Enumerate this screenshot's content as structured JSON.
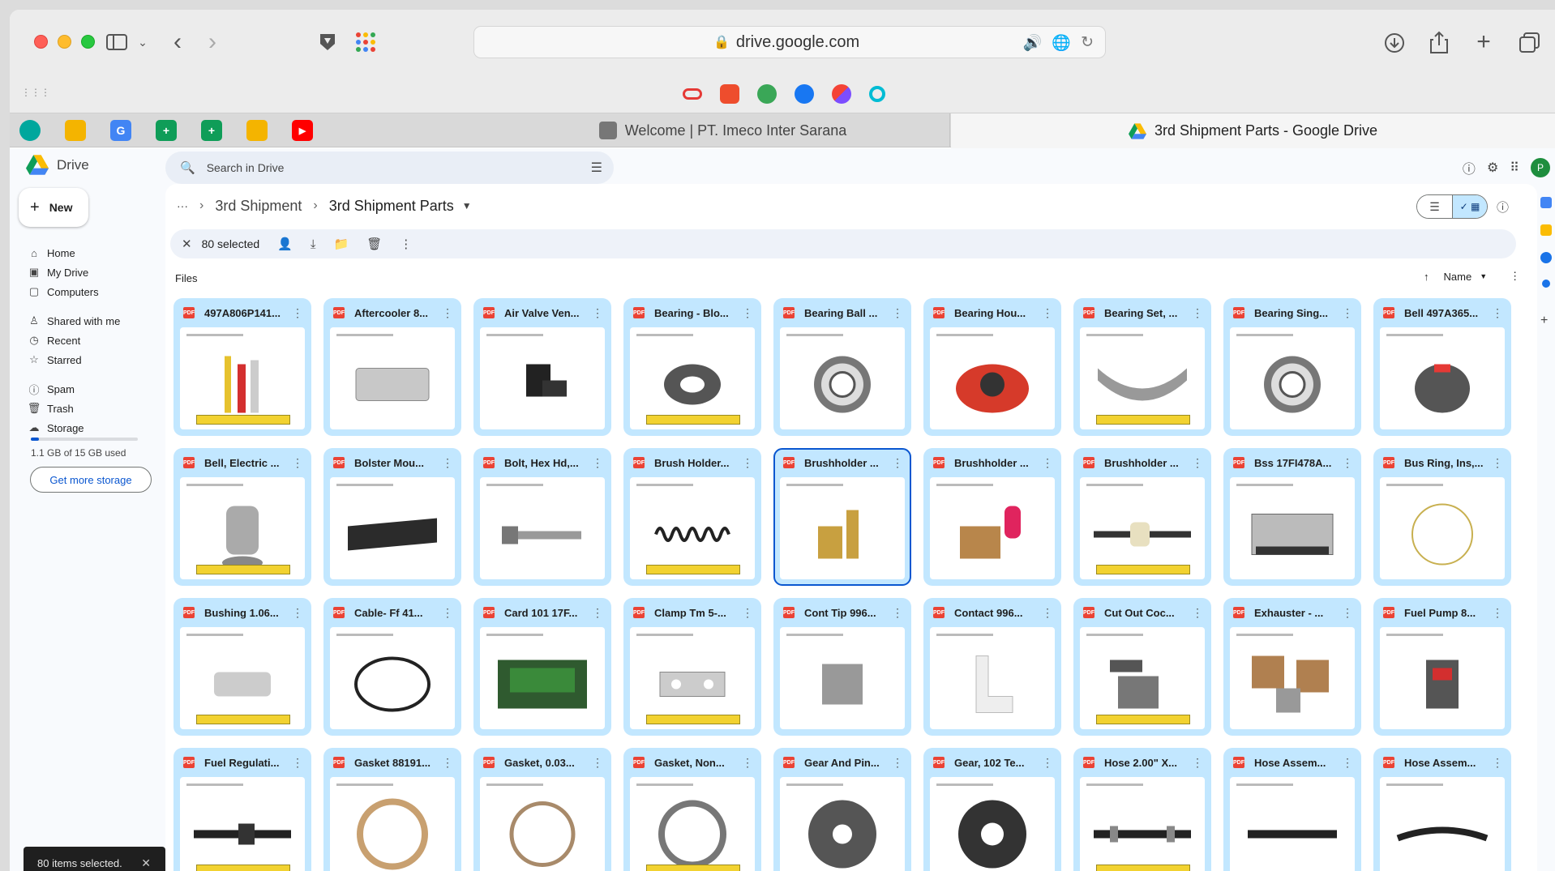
{
  "browser": {
    "url": "drive.google.com",
    "tabs": [
      {
        "title": "Welcome | PT. Imeco Inter Sarana"
      },
      {
        "title": "3rd Shipment Parts - Google Drive"
      }
    ]
  },
  "drive": {
    "app_name": "Drive",
    "search_placeholder": "Search in Drive",
    "new_label": "New",
    "nav": [
      {
        "label": "Home",
        "icon": "home-icon"
      },
      {
        "label": "My Drive",
        "icon": "drive-icon"
      },
      {
        "label": "Computers",
        "icon": "computer-icon"
      },
      {
        "label": "Shared with me",
        "icon": "people-icon"
      },
      {
        "label": "Recent",
        "icon": "clock-icon"
      },
      {
        "label": "Starred",
        "icon": "star-icon"
      },
      {
        "label": "Spam",
        "icon": "spam-icon"
      },
      {
        "label": "Trash",
        "icon": "trash-icon"
      },
      {
        "label": "Storage",
        "icon": "cloud-icon"
      }
    ],
    "storage_used_fraction": 0.073,
    "storage_text": "1.1 GB of 15 GB used",
    "get_storage_label": "Get more storage",
    "snackbar": "80 items selected.",
    "breadcrumb": {
      "ellipsis": "···",
      "parent": "3rd Shipment",
      "current": "3rd Shipment Parts"
    },
    "selection": {
      "count_label": "80 selected"
    },
    "files_label": "Files",
    "sort_label": "Name",
    "files": [
      {
        "name": "497A806P141..."
      },
      {
        "name": "Aftercooler 8..."
      },
      {
        "name": "Air Valve Ven..."
      },
      {
        "name": "Bearing - Blo..."
      },
      {
        "name": "Bearing Ball ..."
      },
      {
        "name": "Bearing Hou..."
      },
      {
        "name": "Bearing Set, ..."
      },
      {
        "name": "Bearing Sing..."
      },
      {
        "name": "Bell 497A365..."
      },
      {
        "name": "Bell, Electric ..."
      },
      {
        "name": "Bolster Mou..."
      },
      {
        "name": "Bolt, Hex Hd,..."
      },
      {
        "name": "Brush Holder..."
      },
      {
        "name": "Brushholder ..."
      },
      {
        "name": "Brushholder ..."
      },
      {
        "name": "Brushholder ..."
      },
      {
        "name": "Bss 17FI478A..."
      },
      {
        "name": "Bus Ring, Ins,..."
      },
      {
        "name": "Bushing 1.06..."
      },
      {
        "name": "Cable- Ff 41..."
      },
      {
        "name": "Card 101 17F..."
      },
      {
        "name": "Clamp Tm 5-..."
      },
      {
        "name": "Cont Tip 996..."
      },
      {
        "name": "Contact 996..."
      },
      {
        "name": "Cut Out Coc..."
      },
      {
        "name": "Exhauster - ..."
      },
      {
        "name": "Fuel Pump 8..."
      },
      {
        "name": "Fuel Regulati..."
      },
      {
        "name": "Gasket 88191..."
      },
      {
        "name": "Gasket, 0.03..."
      },
      {
        "name": "Gasket, Non..."
      },
      {
        "name": "Gear And Pin..."
      },
      {
        "name": "Gear, 102 Te..."
      },
      {
        "name": "Hose 2.00\" X..."
      },
      {
        "name": "Hose Assem..."
      },
      {
        "name": "Hose Assem..."
      }
    ]
  }
}
